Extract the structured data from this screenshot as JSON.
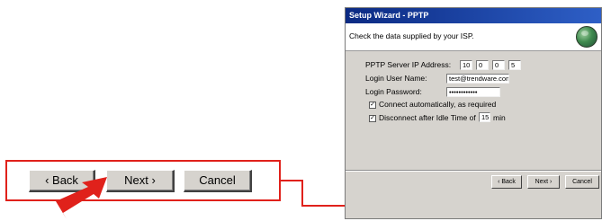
{
  "window": {
    "title": "Setup Wizard - PPTP",
    "header_text": "Check the data supplied by your ISP.",
    "icon": "globe-icon"
  },
  "form": {
    "server_ip_label": "PPTP Server IP Address:",
    "server_ip": [
      "10",
      "0",
      "0",
      "5"
    ],
    "username_label": "Login User Name:",
    "username_value": "test@trendware.com",
    "password_label": "Login Password:",
    "password_value": "••••••••••••",
    "auto_connect_label": "Connect automatically, as required",
    "auto_connect_checked": true,
    "idle_label_prefix": "Disconnect after Idle Time of",
    "idle_value": "15",
    "idle_label_suffix": "min",
    "idle_checked": true
  },
  "buttons": {
    "back": "‹ Back",
    "next": "Next ›",
    "cancel": "Cancel"
  },
  "callout": {
    "back": "‹ Back",
    "next": "Next ›",
    "cancel": "Cancel"
  },
  "colors": {
    "highlight": "#e0211b",
    "title_bar": "#0b2a83",
    "dialog_bg": "#d6d3ce"
  }
}
